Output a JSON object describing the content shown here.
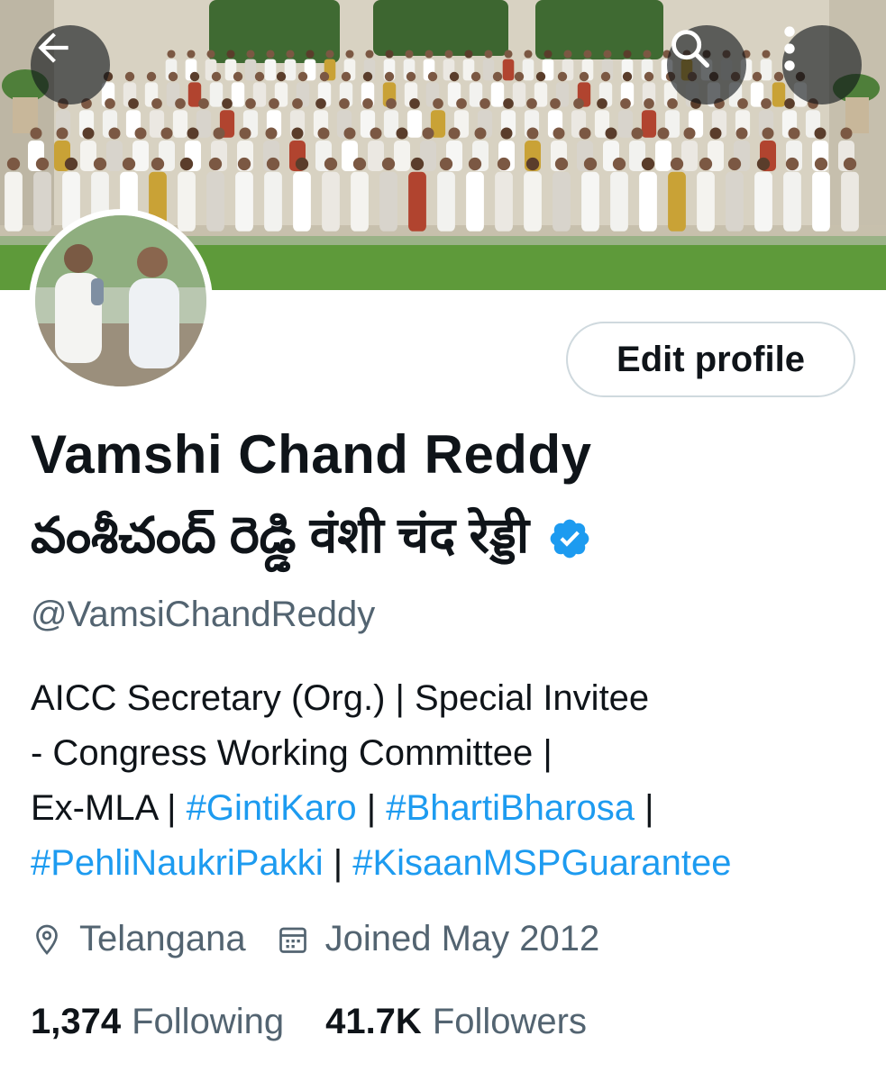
{
  "header": {
    "back_icon": "arrow-left-icon",
    "search_icon": "search-icon",
    "more_icon": "more-vertical-icon",
    "overlay_color": "#0f1419"
  },
  "banner": {
    "description_icon": "group-photo"
  },
  "profile": {
    "edit_button_label": "Edit profile",
    "display_name": "Vamshi Chand Reddy",
    "display_name_local": "వంశీచంద్ రెడ్డి वंशी चंद रेड्डी",
    "verified_icon": "verified-badge-icon",
    "verified_color": "#1d9bf0",
    "handle": "@VamsiChandReddy",
    "bio": {
      "line1": "AICC Secretary (Org.) | Special Invitee",
      "line2": "- Congress Working Committee |",
      "line3_prefix": "Ex-MLA | ",
      "tag1": "#GintiKaro",
      "sep1": " | ",
      "tag2": "#BhartiBharosa",
      "sep2": " |",
      "tag3": "#PehliNaukriPakki",
      "sep3": " | ",
      "tag4": "#KisaanMSPGuarantee"
    },
    "location": "Telangana",
    "location_icon": "location-pin-icon",
    "joined": "Joined May 2012",
    "joined_icon": "calendar-icon",
    "following_count": "1,374",
    "following_label": "Following",
    "followers_count": "41.7K",
    "followers_label": "Followers",
    "link_color": "#1d9bf0"
  }
}
